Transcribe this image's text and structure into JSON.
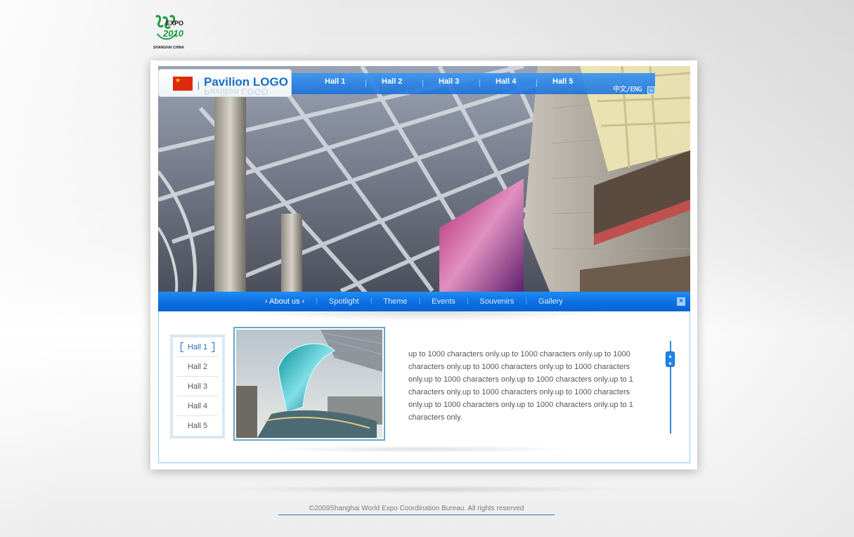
{
  "brand": {
    "expo_word": "EXPO",
    "expo_year": "2010",
    "expo_city": "SHANGHAI CHINA",
    "pavilion_logo": "Pavilion LOGO"
  },
  "header_nav": {
    "items": [
      {
        "label": "Hall 1"
      },
      {
        "label": "Hall 2"
      },
      {
        "label": "Hall 3"
      },
      {
        "label": "Hall 4"
      },
      {
        "label": "Hall 5"
      }
    ],
    "language": "中文/ENG"
  },
  "main_menu": {
    "items": [
      {
        "label": "About us"
      },
      {
        "label": "Spotlight"
      },
      {
        "label": "Theme"
      },
      {
        "label": "Events"
      },
      {
        "label": "Souvenirs"
      },
      {
        "label": "Gallery"
      }
    ],
    "active": "About us"
  },
  "sub_nav": {
    "items": [
      {
        "label": "Hall 1"
      },
      {
        "label": "Hall 2"
      },
      {
        "label": "Hall 3"
      },
      {
        "label": "Hall 4"
      },
      {
        "label": "Hall 5"
      }
    ],
    "active": "Hall 1"
  },
  "content": {
    "description": "up to 1000 characters only.up to 1000 characters only.up to 1000 characters only.up to 1000 characters only.up to 1000 characters only.up to 1000 characters only.up to 1000 characters only.up to 1 characters only.up to 1000 characters only.up to 1000 characters only.up to 1000 characters only.up to 1000 characters only.up to 1 characters only."
  },
  "footer": {
    "copyright": "©2009Shanghai World Expo Coordination Bureau. All rights reserved"
  },
  "colors": {
    "brand_blue": "#1a6fc4",
    "menu_blue": "#0c6fe0",
    "expo_green": "#1d9a3f"
  }
}
